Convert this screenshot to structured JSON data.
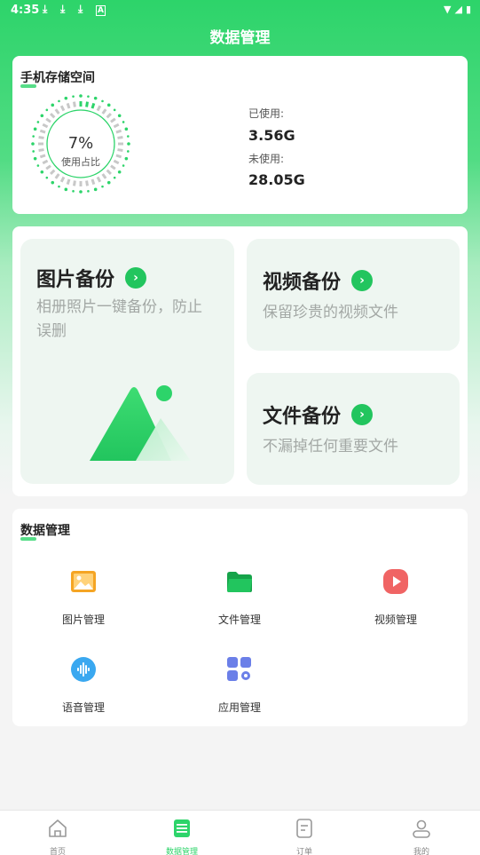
{
  "status_bar": {
    "time": "4:35"
  },
  "header": {
    "title": "数据管理"
  },
  "storage": {
    "title": "手机存储空间",
    "percent_text": "7%",
    "percent_value": 0.07,
    "percent_label": "使用占比",
    "used_label": "已使用:",
    "used_value": "3.56G",
    "free_label": "未使用:",
    "free_value": "28.05G"
  },
  "backup": {
    "photo": {
      "title": "图片备份",
      "desc": "相册照片一键备份，防止误删"
    },
    "video": {
      "title": "视频备份",
      "desc": "保留珍贵的视频文件"
    },
    "file": {
      "title": "文件备份",
      "desc": "不漏掉任何重要文件"
    }
  },
  "manage": {
    "title": "数据管理",
    "items": [
      {
        "label": "图片管理",
        "icon": "image-icon",
        "color": "#f5a524"
      },
      {
        "label": "文件管理",
        "icon": "folder-icon",
        "color": "#22c55e"
      },
      {
        "label": "视频管理",
        "icon": "play-icon",
        "color": "#f06464"
      },
      {
        "label": "语音管理",
        "icon": "voice-icon",
        "color": "#3aa8f0"
      },
      {
        "label": "应用管理",
        "icon": "apps-icon",
        "color": "#6b7fe8"
      }
    ]
  },
  "bottom_nav": [
    {
      "label": "首页",
      "icon": "home-icon",
      "active": false
    },
    {
      "label": "数据管理",
      "icon": "data-icon",
      "active": true
    },
    {
      "label": "订单",
      "icon": "order-icon",
      "active": false
    },
    {
      "label": "我的",
      "icon": "profile-icon",
      "active": false
    }
  ],
  "colors": {
    "accent": "#2dd46a",
    "tile_bg": "#eef6f1"
  }
}
